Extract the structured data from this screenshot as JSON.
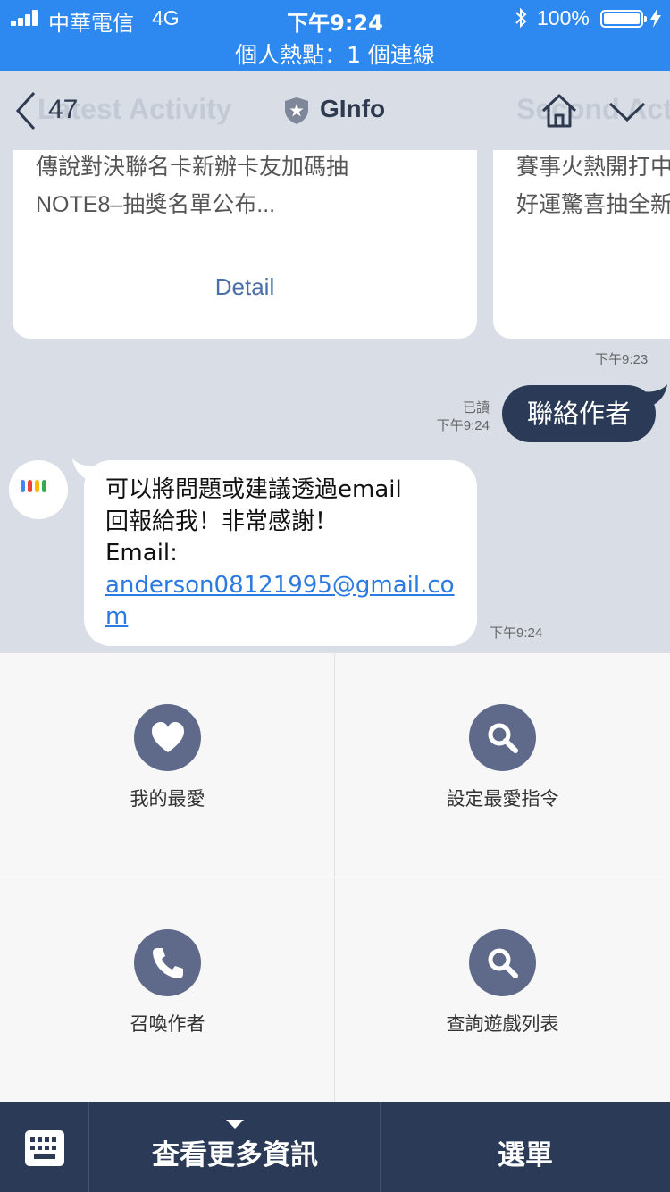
{
  "status_bar": {
    "carrier": "中華電信",
    "network": "4G",
    "time": "下午9:24",
    "battery": "100%",
    "hotspot": "個人熱點：1 個連線",
    "icons": [
      "signal-icon",
      "bluetooth-icon",
      "battery-icon",
      "charging-icon"
    ]
  },
  "header": {
    "back_count": "47",
    "title": "GInfo",
    "ghost_left": "Latest Activity",
    "ghost_right": "Second Acti",
    "icons": [
      "back-chevron-icon",
      "shield-star-icon",
      "home-icon",
      "chevron-down-icon"
    ]
  },
  "chat": {
    "card_left": {
      "line1": "傳說對決聯名卡新辦卡友加碼抽",
      "line2": "NOTE8–抽獎名單公布...",
      "detail": "Detail"
    },
    "card_right": {
      "line1": "賽事火熱開打中",
      "line2": "好運驚喜抽全新"
    },
    "card_time": "下午9:23",
    "read_label": "已讀",
    "my_time": "下午9:24",
    "my_message": "聯絡作者",
    "bot_line1": "可以將問題或建議透過email",
    "bot_line2": "回報給我！非常感謝！",
    "bot_line3": "Email:",
    "bot_email": "anderson08121995@gmail.com",
    "bot_time": "下午9:24"
  },
  "menu": {
    "items": [
      {
        "label": "我的最愛",
        "icon": "heart-icon"
      },
      {
        "label": "設定最愛指令",
        "icon": "search-icon"
      },
      {
        "label": "召喚作者",
        "icon": "phone-icon"
      },
      {
        "label": "查詢遊戲列表",
        "icon": "search-icon"
      }
    ],
    "icon_color": "#5f6a8a"
  },
  "bottom_bar": {
    "more_info": "查看更多資訊",
    "menu": "選單",
    "keyboard_icon": "keyboard-icon"
  },
  "colors": {
    "status_bar": "#2d89ef",
    "chat_bg": "#d8dde6",
    "dark_navy": "#2b3b57",
    "link": "#2a7ae2"
  }
}
